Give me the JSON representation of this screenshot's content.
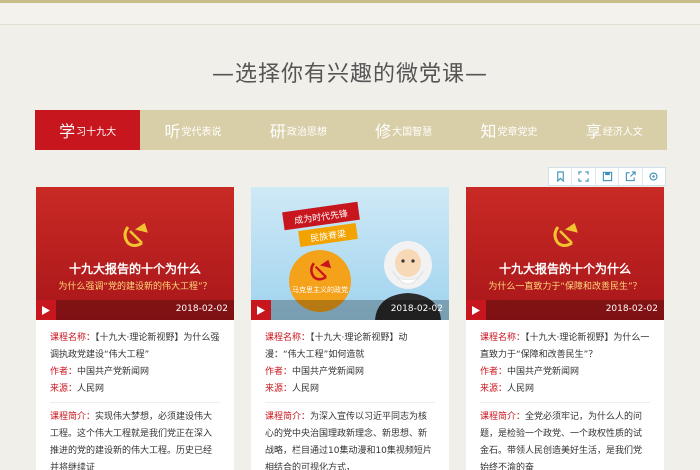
{
  "heading": "—选择你有兴趣的微党课—",
  "tabs": [
    {
      "big": "学",
      "small": "习十九大"
    },
    {
      "big": "听",
      "small": "党代表说"
    },
    {
      "big": "研",
      "small": "政治思想"
    },
    {
      "big": "修",
      "small": "大国智慧"
    },
    {
      "big": "知",
      "small": "党章党史"
    },
    {
      "big": "享",
      "small": "经济人文"
    }
  ],
  "toolbar_icons": [
    "bookmark-icon",
    "expand-icon",
    "save-icon",
    "share-icon",
    "settings-icon"
  ],
  "labels": {
    "name": "课程名称：",
    "author": "作者：",
    "source": "来源：",
    "intro": "课程简介："
  },
  "cards": [
    {
      "thumb_title": "十九大报告的十个为什么",
      "thumb_subtitle": "为什么强调“党的建设新的伟大工程”？",
      "date": "2018-02-02",
      "name": "【十九大·理论新视野】为什么强调执政党建设“伟大工程”",
      "author": "中国共产党新闻网",
      "source": "人民网",
      "intro": "实现伟大梦想，必须建设伟大工程。这个伟大工程就是我们党正在深入推进的党的建设新的伟大工程。历史已经并将继续证"
    },
    {
      "banner1": "成为时代先锋",
      "banner2": "民族脊梁",
      "circle_text": "马克思主义的政党",
      "date": "2018-02-02",
      "name": "【十九大·理论新视野】动漫：“伟大工程”如何造就",
      "author": "中国共产党新闻网",
      "source": "人民网",
      "intro": "为深入宣传以习近平同志为核心的党中央治国理政新理念、新思想、新战略，栏目通过10集动漫和10集视频短片相结合的可视化方式，"
    },
    {
      "thumb_title": "十九大报告的十个为什么",
      "thumb_subtitle": "为什么一直致力于“保障和改善民生”？",
      "date": "2018-02-02",
      "name": "【十九大·理论新视野】为什么一直致力于“保障和改善民生”？",
      "author": "中国共产党新闻网",
      "source": "人民网",
      "intro": "全党必须牢记，为什么人的问题，是检验一个政党、一个政权性质的试金石。带领人民创造美好生活，是我们党始终不渝的奋"
    }
  ],
  "colors": {
    "accent": "#c8161e",
    "tabbar": "#d8cfa8",
    "background": "#f1efe9"
  }
}
